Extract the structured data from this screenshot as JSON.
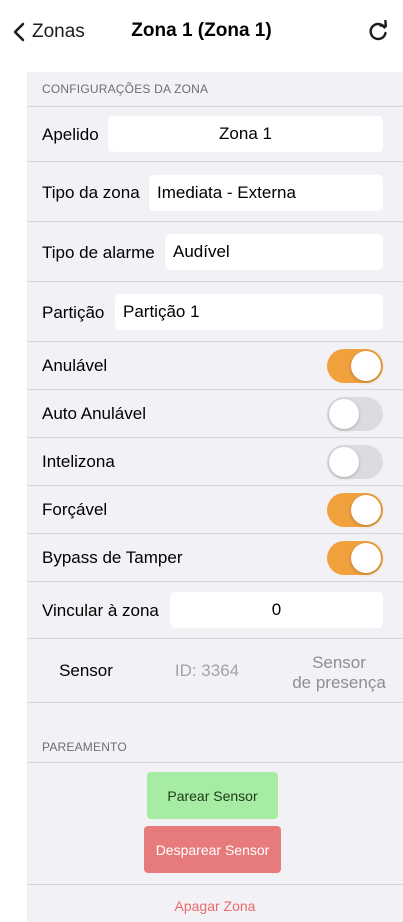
{
  "nav": {
    "back_label": "Zonas",
    "title": "Zona 1 (Zona 1)"
  },
  "config": {
    "header": "CONFIGURAÇÕES DA ZONA",
    "apelido_label": "Apelido",
    "apelido_value": "Zona 1",
    "tipo_zona_label": "Tipo da zona",
    "tipo_zona_value": "Imediata - Externa",
    "tipo_alarme_label": "Tipo de alarme",
    "tipo_alarme_value": "Audível",
    "particao_label": "Partição",
    "particao_value": "Partição 1",
    "toggles": [
      {
        "label": "Anulável",
        "on": true
      },
      {
        "label": "Auto Anulável",
        "on": false
      },
      {
        "label": "Intelizona",
        "on": false
      },
      {
        "label": "Forçável",
        "on": true
      },
      {
        "label": "Bypass de Tamper",
        "on": true
      }
    ],
    "vincular_label": "Vincular à zona",
    "vincular_value": "0",
    "sensor_label": "Sensor",
    "sensor_id": "ID: 3364",
    "sensor_type_line1": "Sensor",
    "sensor_type_line2": "de presença"
  },
  "pairing": {
    "header": "PAREAMENTO",
    "pair_button": "Parear Sensor",
    "unpair_button": "Desparear Sensor",
    "delete_link": "Apagar Zona"
  },
  "colors": {
    "toggle_on": "#f0a03c",
    "toggle_off": "#dcdce0",
    "pair_button": "#a6eca2",
    "unpair_button": "#e77b7b",
    "delete_link": "#e96b6b"
  }
}
